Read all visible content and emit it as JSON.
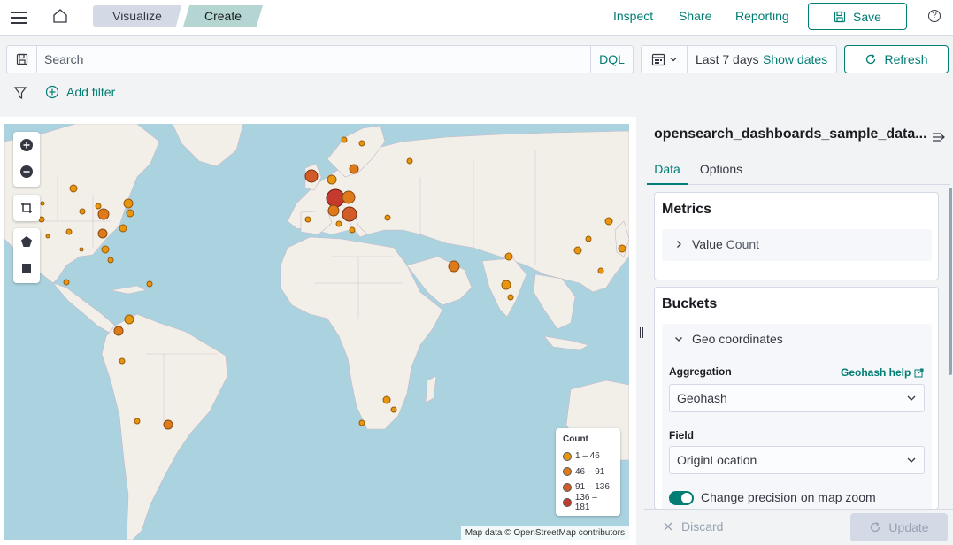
{
  "header": {
    "breadcrumbs": [
      "Visualize",
      "Create"
    ],
    "links": {
      "inspect": "Inspect",
      "share": "Share",
      "reporting": "Reporting"
    },
    "save_label": "Save",
    "help_glyph": "?"
  },
  "query": {
    "search_placeholder": "Search",
    "search_value": "",
    "language": "DQL",
    "date_range": "Last 7 days",
    "show_dates": "Show dates",
    "refresh_label": "Refresh"
  },
  "filters": {
    "add_filter": "Add filter"
  },
  "map": {
    "legend": {
      "title": "Count",
      "items": [
        {
          "label": "1 – 46",
          "color": "#e8950f"
        },
        {
          "label": "46 – 91",
          "color": "#de7a1a"
        },
        {
          "label": "91 – 136",
          "color": "#d25c28"
        },
        {
          "label": "136 – 181",
          "color": "#c63a2e"
        }
      ]
    },
    "attribution": "Map data © OpenStreetMap contributors"
  },
  "sidebar": {
    "index_name": "opensearch_dashboards_sample_data...",
    "tabs": [
      "Data",
      "Options"
    ],
    "metrics": {
      "title": "Metrics",
      "item_prefix": "Value",
      "item_suffix": "Count"
    },
    "buckets": {
      "title": "Buckets",
      "item_label": "Geo coordinates",
      "aggregation_label": "Aggregation",
      "aggregation_help": "Geohash help",
      "aggregation_value": "Geohash",
      "field_label": "Field",
      "field_value": "OriginLocation",
      "precision_toggle": "Change precision on map zoom"
    }
  },
  "footer": {
    "discard": "Discard",
    "update": "Update"
  },
  "colors": {
    "accent": "#017d73",
    "water": "#aad3df",
    "land": "#f2efe9"
  }
}
